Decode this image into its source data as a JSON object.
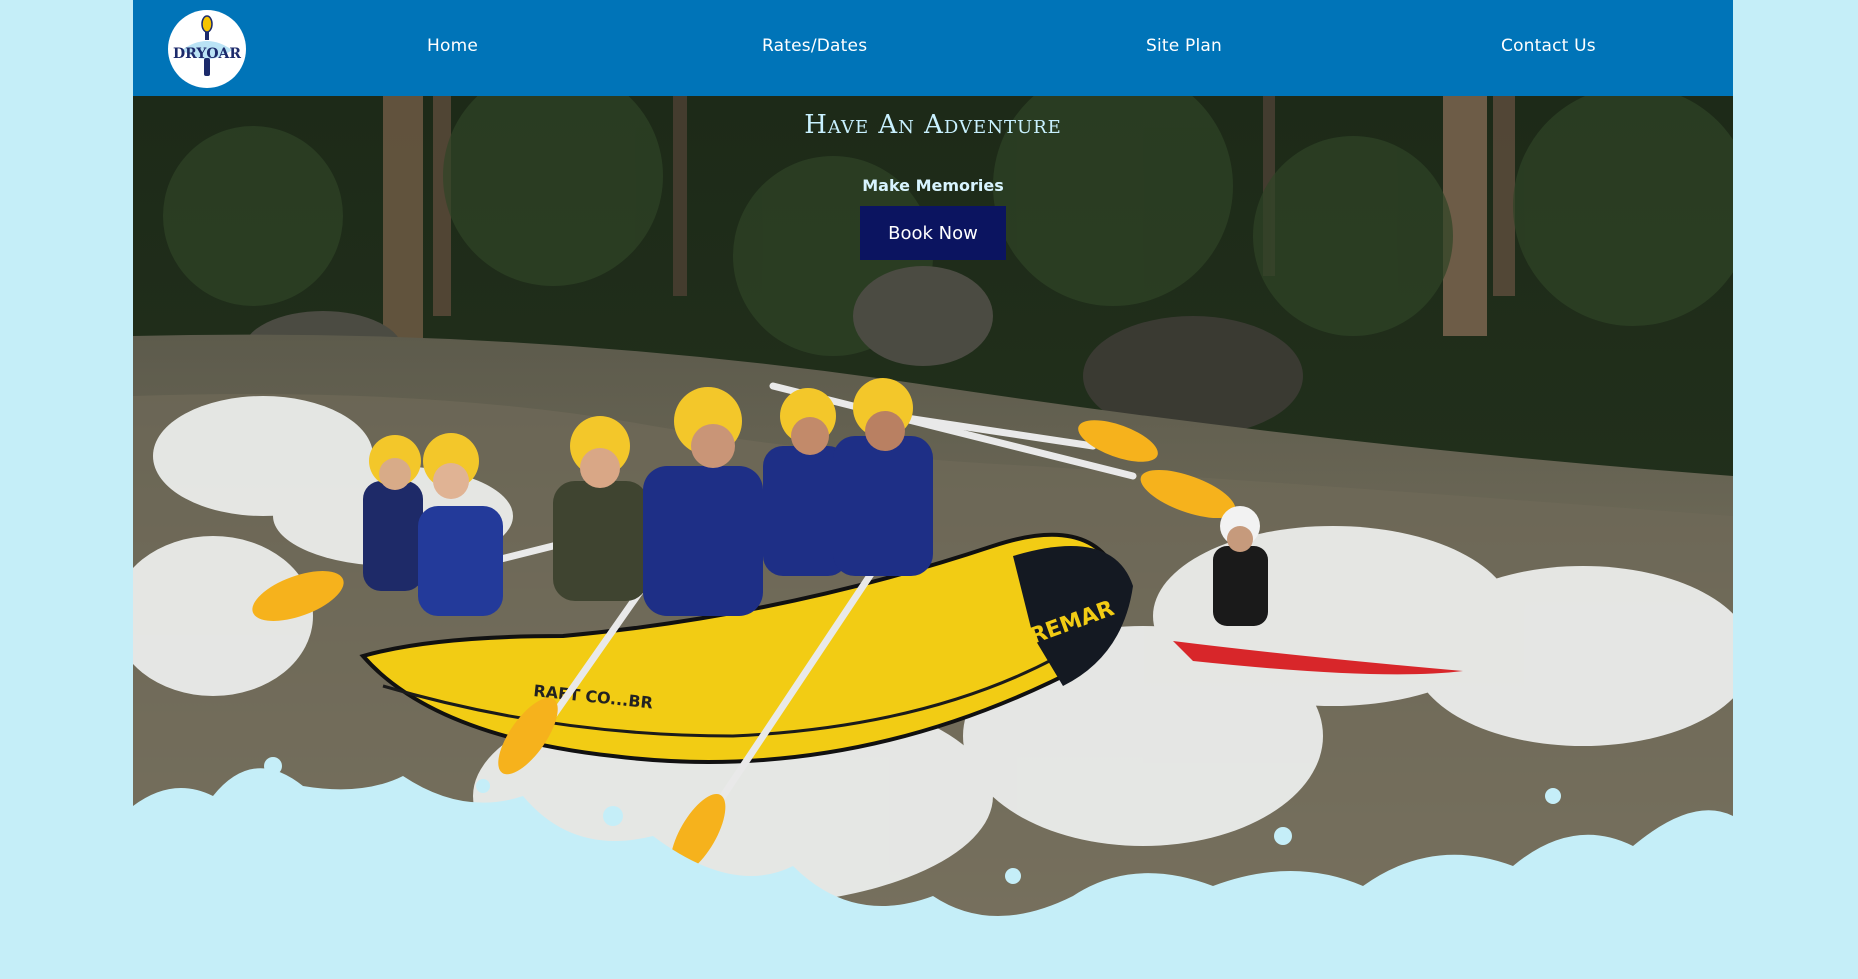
{
  "brand": {
    "logo_text": "DRYOAR"
  },
  "nav": {
    "items": [
      {
        "label": "Home"
      },
      {
        "label": "Rates/Dates"
      },
      {
        "label": "Site Plan"
      },
      {
        "label": "Contact Us"
      }
    ]
  },
  "hero": {
    "title": "Have An Adventure",
    "subtitle": "Make Memories",
    "cta_label": "Book Now",
    "raft_text": "REMAR",
    "raft_side_text": "RAFT CO...BR"
  },
  "colors": {
    "nav_bg": "#0074b8",
    "page_bg": "#c5eef8",
    "button_bg": "#0b1460",
    "title_color": "#c9f1ff"
  }
}
